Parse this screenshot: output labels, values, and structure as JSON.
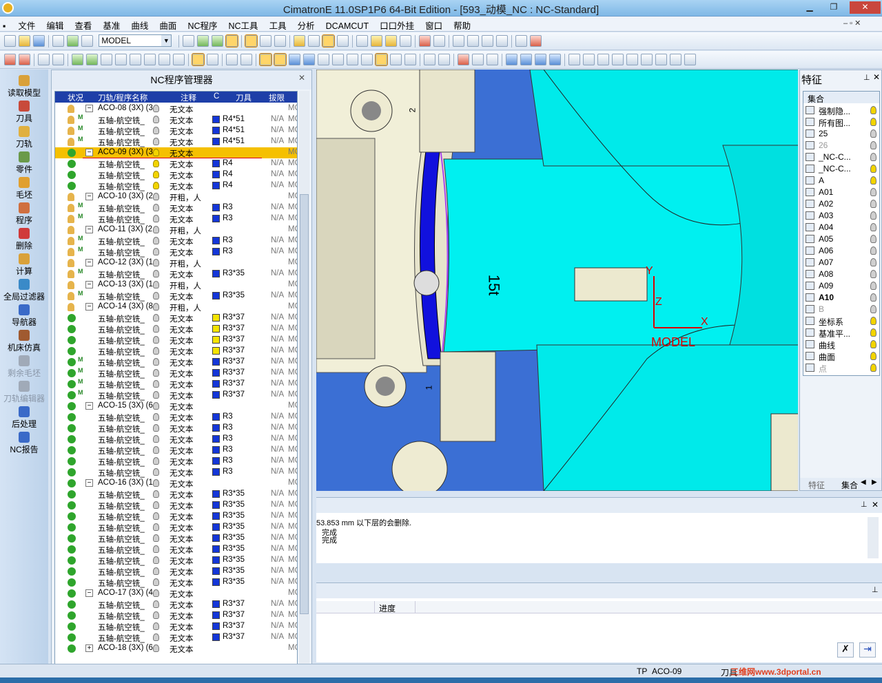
{
  "window": {
    "title": "CimatronE 11.0SP1P6 64-Bit Edition   - [593_动模_NC : NC-Standard]"
  },
  "menu": [
    "文件",
    "编辑",
    "查看",
    "基准",
    "曲线",
    "曲面",
    "NC程序",
    "NC工具",
    "工具",
    "分析",
    "DCAMCUT",
    "口口外挂",
    "窗口",
    "帮助"
  ],
  "toolbar": {
    "model_select": "MODEL"
  },
  "leftbar": [
    {
      "label": "读取模型",
      "color": "#d9a13a",
      "disabled": false
    },
    {
      "label": "刀具",
      "color": "#c84a3a",
      "disabled": false
    },
    {
      "label": "刀轨",
      "color": "#e0b040",
      "disabled": false
    },
    {
      "label": "零件",
      "color": "#6a9a4a",
      "disabled": false
    },
    {
      "label": "毛坯",
      "color": "#e0a030",
      "disabled": false
    },
    {
      "label": "程序",
      "color": "#d07040",
      "disabled": false
    },
    {
      "label": "删除",
      "color": "#d03a3a",
      "disabled": false
    },
    {
      "label": "计算",
      "color": "#d9a13a",
      "disabled": false
    },
    {
      "label": "全局过滤器",
      "color": "#3a8ac8",
      "disabled": false
    },
    {
      "label": "导航器",
      "color": "#3a6ac8",
      "disabled": false
    },
    {
      "label": "机床仿真",
      "color": "#a05a30",
      "disabled": false
    },
    {
      "label": "剩余毛坯",
      "color": "#a0aab8",
      "disabled": true
    },
    {
      "label": "刀轨编辑器",
      "color": "#a0aab8",
      "disabled": true
    },
    {
      "label": "后处理",
      "color": "#3a6ac8",
      "disabled": false
    },
    {
      "label": "NC报告",
      "color": "#3a6ac8",
      "disabled": false
    }
  ],
  "nc_panel": {
    "title": "NC程序管理器",
    "columns": [
      "状况",
      "刀轨/程序名称",
      "",
      "注释",
      "C",
      "刀具",
      "拔限"
    ],
    "rows": [
      {
        "status": "hand",
        "m": "",
        "tog": "−",
        "name": "ACO-08 (3X) (3",
        "bulb": "off",
        "note": "无文本",
        "tcol": "",
        "tool": "",
        "na": "",
        "mc": "MC",
        "group": true
      },
      {
        "status": "hand",
        "m": "M",
        "tog": "",
        "name": "五轴-航空铣_",
        "bulb": "off",
        "note": "无文本",
        "tcol": "#1436d8",
        "tool": "R4*51",
        "na": "N/A",
        "mc": "MC"
      },
      {
        "status": "hand",
        "m": "M",
        "tog": "",
        "name": "五轴-航空铣_",
        "bulb": "off",
        "note": "无文本",
        "tcol": "#1436d8",
        "tool": "R4*51",
        "na": "N/A",
        "mc": "MC"
      },
      {
        "status": "hand",
        "m": "M",
        "tog": "",
        "name": "五轴-航空铣_",
        "bulb": "off",
        "note": "无文本",
        "tcol": "#1436d8",
        "tool": "R4*51",
        "na": "N/A",
        "mc": "MC"
      },
      {
        "status": "ok",
        "m": "",
        "tog": "−",
        "name": "ACO-09 (3X) (3",
        "bulb": "on",
        "note": "无文本",
        "tcol": "",
        "tool": "",
        "na": "",
        "mc": "MC",
        "group": true,
        "selected": true
      },
      {
        "status": "ok",
        "m": "",
        "tog": "",
        "name": "五轴-航空铣_",
        "bulb": "on",
        "note": "无文本",
        "tcol": "#1436d8",
        "tool": "R4",
        "na": "N/A",
        "mc": "MC"
      },
      {
        "status": "ok",
        "m": "",
        "tog": "",
        "name": "五轴-航空铣_",
        "bulb": "on",
        "note": "无文本",
        "tcol": "#1436d8",
        "tool": "R4",
        "na": "N/A",
        "mc": "MC"
      },
      {
        "status": "ok",
        "m": "",
        "tog": "",
        "name": "五轴-航空铣_",
        "bulb": "on",
        "note": "无文本",
        "tcol": "#1436d8",
        "tool": "R4",
        "na": "N/A",
        "mc": "MC"
      },
      {
        "status": "hand",
        "m": "",
        "tog": "−",
        "name": "ACO-10 (3X) (2",
        "bulb": "off",
        "note": "开粗，人",
        "tcol": "",
        "tool": "",
        "na": "",
        "mc": "MC",
        "group": true
      },
      {
        "status": "hand",
        "m": "M",
        "tog": "",
        "name": "五轴-航空铣_",
        "bulb": "off",
        "note": "无文本",
        "tcol": "#1436d8",
        "tool": "R3",
        "na": "N/A",
        "mc": "MC"
      },
      {
        "status": "hand",
        "m": "M",
        "tog": "",
        "name": "五轴-航空铣_",
        "bulb": "off",
        "note": "无文本",
        "tcol": "#1436d8",
        "tool": "R3",
        "na": "N/A",
        "mc": "MC"
      },
      {
        "status": "hand",
        "m": "",
        "tog": "−",
        "name": "ACO-11 (3X) (2",
        "bulb": "off",
        "note": "开粗，人",
        "tcol": "",
        "tool": "",
        "na": "",
        "mc": "MC",
        "group": true
      },
      {
        "status": "hand",
        "m": "M",
        "tog": "",
        "name": "五轴-航空铣_",
        "bulb": "off",
        "note": "无文本",
        "tcol": "#1436d8",
        "tool": "R3",
        "na": "N/A",
        "mc": "MC"
      },
      {
        "status": "hand",
        "m": "M",
        "tog": "",
        "name": "五轴-航空铣_",
        "bulb": "off",
        "note": "无文本",
        "tcol": "#1436d8",
        "tool": "R3",
        "na": "N/A",
        "mc": "MC"
      },
      {
        "status": "hand",
        "m": "",
        "tog": "−",
        "name": "ACO-12 (3X) (1",
        "bulb": "off",
        "note": "开粗，人",
        "tcol": "",
        "tool": "",
        "na": "",
        "mc": "MC",
        "group": true
      },
      {
        "status": "hand",
        "m": "M",
        "tog": "",
        "name": "五轴-航空铣_",
        "bulb": "off",
        "note": "无文本",
        "tcol": "#1436d8",
        "tool": "R3*35",
        "na": "N/A",
        "mc": "MC"
      },
      {
        "status": "hand",
        "m": "",
        "tog": "−",
        "name": "ACO-13 (3X) (1",
        "bulb": "off",
        "note": "开粗，人",
        "tcol": "",
        "tool": "",
        "na": "",
        "mc": "MC",
        "group": true
      },
      {
        "status": "hand",
        "m": "M",
        "tog": "",
        "name": "五轴-航空铣_",
        "bulb": "off",
        "note": "无文本",
        "tcol": "#1436d8",
        "tool": "R3*35",
        "na": "N/A",
        "mc": "MC"
      },
      {
        "status": "hand",
        "m": "",
        "tog": "−",
        "name": "ACO-14 (3X) (8",
        "bulb": "off",
        "note": "开粗，人",
        "tcol": "",
        "tool": "",
        "na": "",
        "mc": "MC",
        "group": true
      },
      {
        "status": "ok",
        "m": "",
        "tog": "",
        "name": "五轴-航空铣_",
        "bulb": "off",
        "note": "无文本",
        "tcol": "#f4e400",
        "tool": "R3*37",
        "na": "N/A",
        "mc": "MC"
      },
      {
        "status": "ok",
        "m": "",
        "tog": "",
        "name": "五轴-航空铣_",
        "bulb": "off",
        "note": "无文本",
        "tcol": "#f4e400",
        "tool": "R3*37",
        "na": "N/A",
        "mc": "MC"
      },
      {
        "status": "ok",
        "m": "",
        "tog": "",
        "name": "五轴-航空铣_",
        "bulb": "off",
        "note": "无文本",
        "tcol": "#f4e400",
        "tool": "R3*37",
        "na": "N/A",
        "mc": "MC"
      },
      {
        "status": "ok",
        "m": "",
        "tog": "",
        "name": "五轴-航空铣_",
        "bulb": "off",
        "note": "无文本",
        "tcol": "#f4e400",
        "tool": "R3*37",
        "na": "N/A",
        "mc": "MC"
      },
      {
        "status": "ok",
        "m": "M",
        "tog": "",
        "name": "五轴-航空铣_",
        "bulb": "off",
        "note": "无文本",
        "tcol": "#1436d8",
        "tool": "R3*37",
        "na": "N/A",
        "mc": "MC"
      },
      {
        "status": "ok",
        "m": "M",
        "tog": "",
        "name": "五轴-航空铣_",
        "bulb": "off",
        "note": "无文本",
        "tcol": "#1436d8",
        "tool": "R3*37",
        "na": "N/A",
        "mc": "MC"
      },
      {
        "status": "ok",
        "m": "M",
        "tog": "",
        "name": "五轴-航空铣_",
        "bulb": "off",
        "note": "无文本",
        "tcol": "#1436d8",
        "tool": "R3*37",
        "na": "N/A",
        "mc": "MC"
      },
      {
        "status": "ok",
        "m": "M",
        "tog": "",
        "name": "五轴-航空铣_",
        "bulb": "off",
        "note": "无文本",
        "tcol": "#1436d8",
        "tool": "R3*37",
        "na": "N/A",
        "mc": "MC"
      },
      {
        "status": "ok",
        "m": "",
        "tog": "−",
        "name": "ACO-15 (3X) (6",
        "bulb": "off",
        "note": "无文本",
        "tcol": "",
        "tool": "",
        "na": "",
        "mc": "MC",
        "group": true
      },
      {
        "status": "ok",
        "m": "",
        "tog": "",
        "name": "五轴-航空铣_",
        "bulb": "off",
        "note": "无文本",
        "tcol": "#1436d8",
        "tool": "R3",
        "na": "N/A",
        "mc": "MC"
      },
      {
        "status": "ok",
        "m": "",
        "tog": "",
        "name": "五轴-航空铣_",
        "bulb": "off",
        "note": "无文本",
        "tcol": "#1436d8",
        "tool": "R3",
        "na": "N/A",
        "mc": "MC"
      },
      {
        "status": "ok",
        "m": "",
        "tog": "",
        "name": "五轴-航空铣_",
        "bulb": "off",
        "note": "无文本",
        "tcol": "#1436d8",
        "tool": "R3",
        "na": "N/A",
        "mc": "MC"
      },
      {
        "status": "ok",
        "m": "",
        "tog": "",
        "name": "五轴-航空铣_",
        "bulb": "off",
        "note": "无文本",
        "tcol": "#1436d8",
        "tool": "R3",
        "na": "N/A",
        "mc": "MC"
      },
      {
        "status": "ok",
        "m": "",
        "tog": "",
        "name": "五轴-航空铣_",
        "bulb": "off",
        "note": "无文本",
        "tcol": "#1436d8",
        "tool": "R3",
        "na": "N/A",
        "mc": "MC"
      },
      {
        "status": "ok",
        "m": "",
        "tog": "",
        "name": "五轴-航空铣_",
        "bulb": "off",
        "note": "无文本",
        "tcol": "#1436d8",
        "tool": "R3",
        "na": "N/A",
        "mc": "MC"
      },
      {
        "status": "ok",
        "m": "",
        "tog": "−",
        "name": "ACO-16 (3X) (1",
        "bulb": "off",
        "note": "无文本",
        "tcol": "",
        "tool": "",
        "na": "",
        "mc": "MC",
        "group": true
      },
      {
        "status": "ok",
        "m": "",
        "tog": "",
        "name": "五轴-航空铣_",
        "bulb": "off",
        "note": "无文本",
        "tcol": "#1436d8",
        "tool": "R3*35",
        "na": "N/A",
        "mc": "MC"
      },
      {
        "status": "ok",
        "m": "",
        "tog": "",
        "name": "五轴-航空铣_",
        "bulb": "off",
        "note": "无文本",
        "tcol": "#1436d8",
        "tool": "R3*35",
        "na": "N/A",
        "mc": "MC"
      },
      {
        "status": "ok",
        "m": "",
        "tog": "",
        "name": "五轴-航空铣_",
        "bulb": "off",
        "note": "无文本",
        "tcol": "#1436d8",
        "tool": "R3*35",
        "na": "N/A",
        "mc": "MC"
      },
      {
        "status": "ok",
        "m": "",
        "tog": "",
        "name": "五轴-航空铣_",
        "bulb": "off",
        "note": "无文本",
        "tcol": "#1436d8",
        "tool": "R3*35",
        "na": "N/A",
        "mc": "MC"
      },
      {
        "status": "ok",
        "m": "",
        "tog": "",
        "name": "五轴-航空铣_",
        "bulb": "off",
        "note": "无文本",
        "tcol": "#1436d8",
        "tool": "R3*35",
        "na": "N/A",
        "mc": "MC"
      },
      {
        "status": "ok",
        "m": "",
        "tog": "",
        "name": "五轴-航空铣_",
        "bulb": "off",
        "note": "无文本",
        "tcol": "#1436d8",
        "tool": "R3*35",
        "na": "N/A",
        "mc": "MC"
      },
      {
        "status": "ok",
        "m": "",
        "tog": "",
        "name": "五轴-航空铣_",
        "bulb": "off",
        "note": "无文本",
        "tcol": "#1436d8",
        "tool": "R3*35",
        "na": "N/A",
        "mc": "MC"
      },
      {
        "status": "ok",
        "m": "",
        "tog": "",
        "name": "五轴-航空铣_",
        "bulb": "off",
        "note": "无文本",
        "tcol": "#1436d8",
        "tool": "R3*35",
        "na": "N/A",
        "mc": "MC"
      },
      {
        "status": "ok",
        "m": "",
        "tog": "",
        "name": "五轴-航空铣_",
        "bulb": "off",
        "note": "无文本",
        "tcol": "#1436d8",
        "tool": "R3*35",
        "na": "N/A",
        "mc": "MC"
      },
      {
        "status": "ok",
        "m": "",
        "tog": "−",
        "name": "ACO-17 (3X) (4",
        "bulb": "off",
        "note": "无文本",
        "tcol": "",
        "tool": "",
        "na": "",
        "mc": "MC",
        "group": true
      },
      {
        "status": "ok",
        "m": "",
        "tog": "",
        "name": "五轴-航空铣_",
        "bulb": "off",
        "note": "无文本",
        "tcol": "#1436d8",
        "tool": "R3*37",
        "na": "N/A",
        "mc": "MC"
      },
      {
        "status": "ok",
        "m": "",
        "tog": "",
        "name": "五轴-航空铣_",
        "bulb": "off",
        "note": "无文本",
        "tcol": "#1436d8",
        "tool": "R3*37",
        "na": "N/A",
        "mc": "MC"
      },
      {
        "status": "ok",
        "m": "",
        "tog": "",
        "name": "五轴-航空铣_",
        "bulb": "off",
        "note": "无文本",
        "tcol": "#1436d8",
        "tool": "R3*37",
        "na": "N/A",
        "mc": "MC"
      },
      {
        "status": "ok",
        "m": "",
        "tog": "",
        "name": "五轴-航空铣_",
        "bulb": "off",
        "note": "无文本",
        "tcol": "#1436d8",
        "tool": "R3*37",
        "na": "N/A",
        "mc": "MC"
      },
      {
        "status": "ok",
        "m": "",
        "tog": "+",
        "name": "ACO-18 (3X) (6",
        "bulb": "off",
        "note": "无文本",
        "tcol": "",
        "tool": "",
        "na": "",
        "mc": "MC",
        "group": true
      }
    ]
  },
  "viewport": {
    "label_2": "2",
    "label_1": "1",
    "part_number": "15t",
    "axis_x": "X",
    "axis_y": "Y",
    "axis_z": "Z",
    "model_label": "MODEL"
  },
  "feature_panel": {
    "title": "特征",
    "header": "集合",
    "items": [
      {
        "label": "强制隐...",
        "bulb": "on",
        "dim": false,
        "bold": false
      },
      {
        "label": "所有图...",
        "bulb": "on",
        "dim": false,
        "bold": false
      },
      {
        "label": "25",
        "bulb": "off",
        "dim": false,
        "bold": false
      },
      {
        "label": "26",
        "bulb": "off",
        "dim": true,
        "bold": false
      },
      {
        "label": "_NC-C...",
        "bulb": "off",
        "dim": false,
        "bold": false
      },
      {
        "label": "_NC-C...",
        "bulb": "on",
        "dim": false,
        "bold": false
      },
      {
        "label": "A",
        "bulb": "on",
        "dim": false,
        "bold": false
      },
      {
        "label": "A01",
        "bulb": "off",
        "dim": false,
        "bold": false
      },
      {
        "label": "A02",
        "bulb": "off",
        "dim": false,
        "bold": false
      },
      {
        "label": "A03",
        "bulb": "off",
        "dim": false,
        "bold": false
      },
      {
        "label": "A04",
        "bulb": "off",
        "dim": false,
        "bold": false
      },
      {
        "label": "A05",
        "bulb": "off",
        "dim": false,
        "bold": false
      },
      {
        "label": "A06",
        "bulb": "off",
        "dim": false,
        "bold": false
      },
      {
        "label": "A07",
        "bulb": "off",
        "dim": false,
        "bold": false
      },
      {
        "label": "A08",
        "bulb": "off",
        "dim": false,
        "bold": false
      },
      {
        "label": "A09",
        "bulb": "off",
        "dim": false,
        "bold": false
      },
      {
        "label": "A10",
        "bulb": "off",
        "dim": false,
        "bold": true
      },
      {
        "label": "B",
        "bulb": "off",
        "dim": true,
        "bold": false
      },
      {
        "label": "坐标系",
        "bulb": "on",
        "dim": false,
        "bold": false
      },
      {
        "label": "基准平...",
        "bulb": "on",
        "dim": false,
        "bold": false
      },
      {
        "label": "曲线",
        "bulb": "on",
        "dim": false,
        "bold": false
      },
      {
        "label": "曲面",
        "bulb": "on",
        "dim": false,
        "bold": false
      },
      {
        "label": "点",
        "bulb": "on",
        "dim": true,
        "bold": false
      }
    ],
    "tabs": [
      "特征",
      "集合"
    ]
  },
  "messages": {
    "lines": [
      "53.853 mm 以下层的会删除.",
      "完成",
      "完成"
    ]
  },
  "progress": {
    "column": "进度"
  },
  "status": {
    "tp_label": "TP",
    "tp_value": "ACO-09",
    "tool_label": "刀具"
  },
  "watermark": "三维网www.3dportal.cn"
}
